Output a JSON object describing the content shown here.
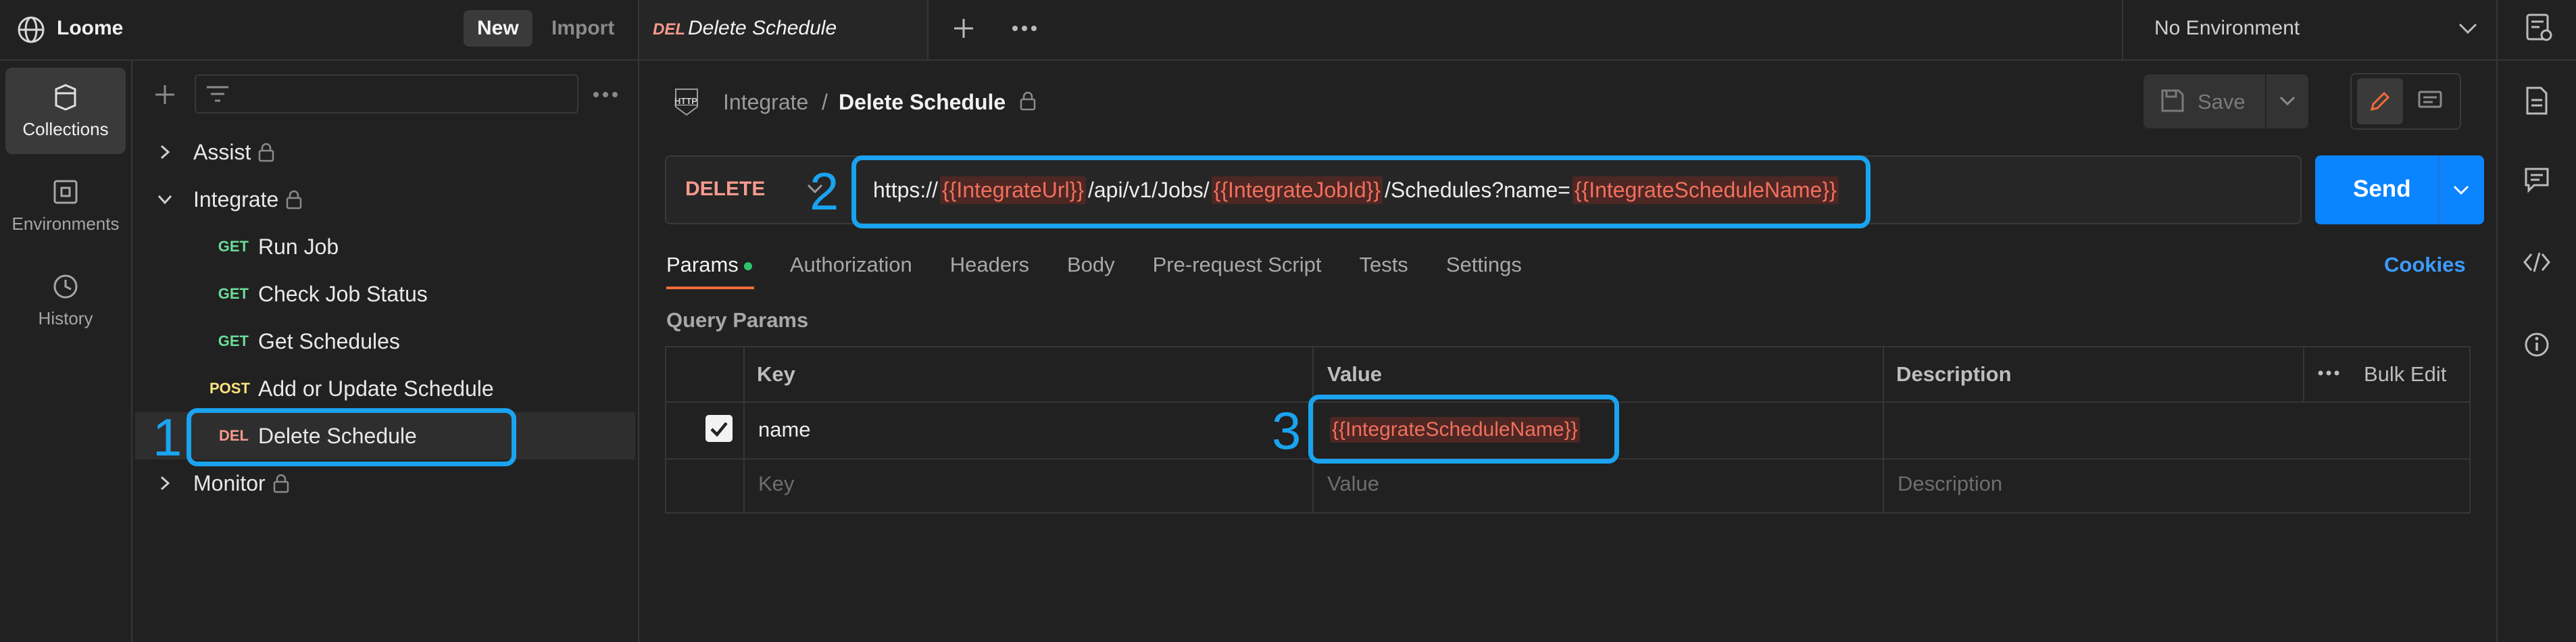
{
  "workspace": {
    "name": "Loome",
    "new_label": "New",
    "import_label": "Import"
  },
  "request_tab": {
    "method_badge": "DEL",
    "title": "Delete Schedule"
  },
  "environment": {
    "selected": "No Environment"
  },
  "rail": [
    {
      "label": "Collections",
      "icon": "collections-icon"
    },
    {
      "label": "Environments",
      "icon": "environments-icon"
    },
    {
      "label": "History",
      "icon": "history-icon"
    }
  ],
  "tree": {
    "folders": [
      "Assist",
      "Integrate",
      "Monitor"
    ],
    "requests": [
      {
        "method": "GET",
        "name": "Run Job"
      },
      {
        "method": "GET",
        "name": "Check Job Status"
      },
      {
        "method": "GET",
        "name": "Get Schedules"
      },
      {
        "method": "POST",
        "name": "Add or Update Schedule"
      },
      {
        "method": "DEL",
        "name": "Delete Schedule"
      }
    ]
  },
  "breadcrumb": {
    "badge": "HTTP",
    "parent": "Integrate",
    "separator": "/",
    "current": "Delete Schedule"
  },
  "save_label": "Save",
  "url_bar": {
    "method": "DELETE",
    "url_parts": [
      "https://",
      "{{IntegrateUrl}}",
      "/api/v1/Jobs/",
      "{{IntegrateJobId}}",
      "/Schedules?name=",
      "{{IntegrateScheduleName}}"
    ],
    "send_label": "Send"
  },
  "request_tabs": [
    "Params",
    "Authorization",
    "Headers",
    "Body",
    "Pre-request Script",
    "Tests",
    "Settings"
  ],
  "cookies_label": "Cookies",
  "query_params": {
    "title": "Query Params",
    "columns": [
      "Key",
      "Value",
      "Description"
    ],
    "bulk_edit": "Bulk Edit",
    "rows": [
      {
        "checked": true,
        "key": "name",
        "value": "{{IntegrateScheduleName}}",
        "description": ""
      }
    ],
    "placeholder": {
      "key": "Key",
      "value": "Value",
      "description": "Description"
    }
  },
  "annotations": [
    "1",
    "2",
    "3"
  ],
  "colors": {
    "accent": "#1aa3ef",
    "send": "#0a84ff",
    "variable": "#f0705c",
    "get": "#6bdd9a",
    "post": "#ffe47e",
    "delete": "#f79a8e"
  }
}
